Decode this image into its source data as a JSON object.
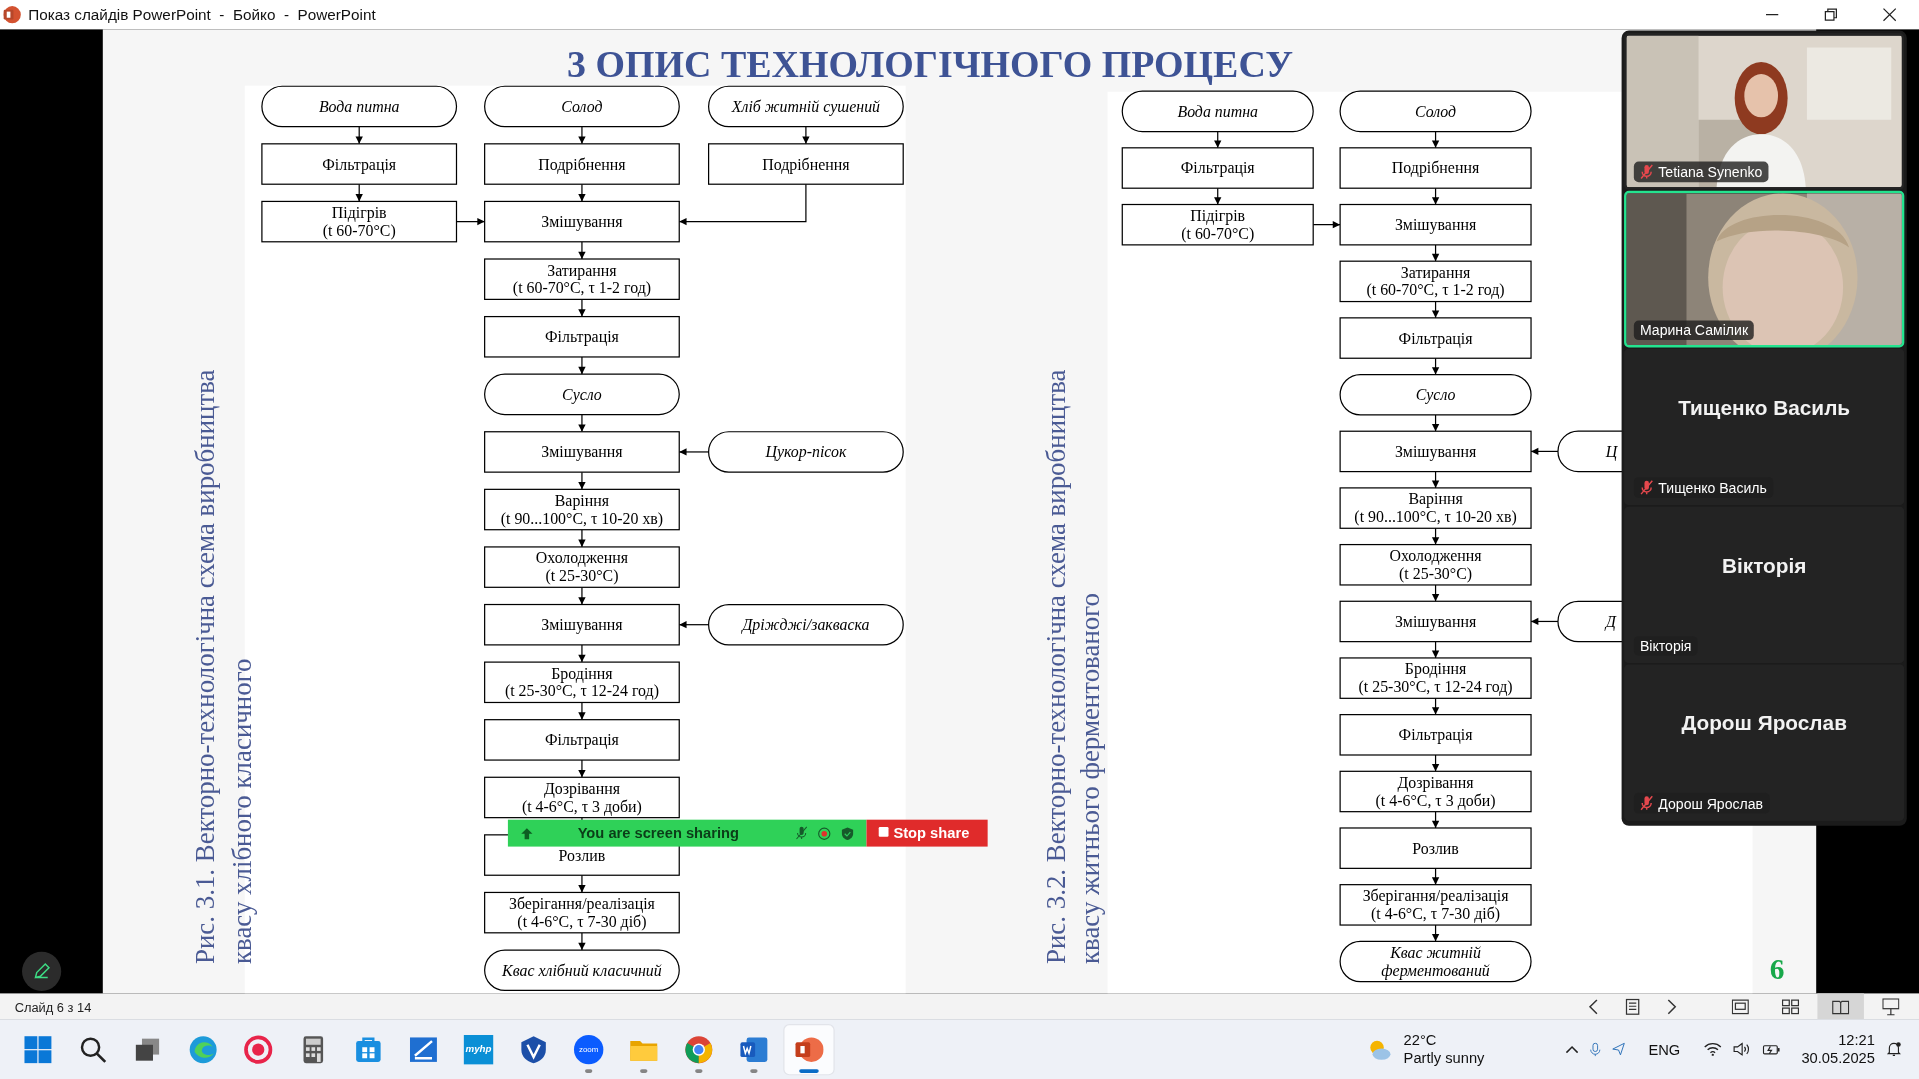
{
  "window": {
    "title": "Показ слайдів PowerPoint  -  Бойко  -  PowerPoint"
  },
  "slide": {
    "title": "3 ОПИС ТЕХНОЛОГІЧНОГО ПРОЦЕСУ",
    "page_number": "6",
    "figures": [
      {
        "caption": [
          "Рис. 3.1. Векторно-технологічна схема виробництва",
          "квасу хлібного класичного"
        ],
        "main": [
          {
            "kind": "terminal",
            "lines": [
              "Солод"
            ]
          },
          {
            "kind": "process",
            "lines": [
              "Подрібнення"
            ]
          },
          {
            "kind": "process",
            "lines": [
              "Змішування"
            ]
          },
          {
            "kind": "process",
            "lines": [
              "Затирання",
              "(t 60-70°C, τ 1-2 год)"
            ]
          },
          {
            "kind": "process",
            "lines": [
              "Фільтрація"
            ]
          },
          {
            "kind": "terminal",
            "lines": [
              "Сусло"
            ]
          },
          {
            "kind": "process",
            "lines": [
              "Змішування"
            ]
          },
          {
            "kind": "process",
            "lines": [
              "Варіння",
              "(t 90...100°C, τ 10-20 хв)"
            ]
          },
          {
            "kind": "process",
            "lines": [
              "Охолодження",
              "(t 25-30°C)"
            ]
          },
          {
            "kind": "process",
            "lines": [
              "Змішування"
            ]
          },
          {
            "kind": "process",
            "lines": [
              "Бродіння",
              "(t 25-30°C, τ 12-24 год)"
            ]
          },
          {
            "kind": "process",
            "lines": [
              "Фільтрація"
            ]
          },
          {
            "kind": "process",
            "lines": [
              "Дозрівання",
              "(t 4-6°C, τ 3 доби)"
            ]
          },
          {
            "kind": "process",
            "lines": [
              "Розлив"
            ]
          },
          {
            "kind": "process",
            "lines": [
              "Зберігання/реалізація",
              "(t 4-6°C, τ 7-30 діб)"
            ]
          },
          {
            "kind": "terminal",
            "lines": [
              "Квас хлібний класичний"
            ]
          }
        ],
        "branches": [
          {
            "nodes": [
              {
                "kind": "terminal",
                "lines": [
                  "Вода питна"
                ]
              },
              {
                "kind": "process",
                "lines": [
                  "Фільтрація"
                ]
              },
              {
                "kind": "process",
                "lines": [
                  "Підігрів",
                  "(t 60-70°C)"
                ]
              }
            ]
          },
          {
            "nodes": [
              {
                "kind": "terminal",
                "lines": [
                  "Хліб житній сушений"
                ]
              },
              {
                "kind": "process",
                "lines": [
                  "Подрібнення"
                ]
              }
            ]
          },
          {
            "nodes": [
              {
                "kind": "terminal",
                "lines": [
                  "Цукор-пісок"
                ]
              }
            ]
          },
          {
            "nodes": [
              {
                "kind": "terminal",
                "lines": [
                  "Дріжджі/закваска"
                ]
              }
            ]
          }
        ]
      },
      {
        "caption": [
          "Рис. 3.2. Векторно-технологічна схема виробництва",
          "квасу житнього ферментованого"
        ],
        "main": [
          {
            "kind": "terminal",
            "lines": [
              "Солод"
            ]
          },
          {
            "kind": "process",
            "lines": [
              "Подрібнення"
            ]
          },
          {
            "kind": "process",
            "lines": [
              "Змішування"
            ]
          },
          {
            "kind": "process",
            "lines": [
              "Затирання",
              "(t 60-70°C, τ 1-2 год)"
            ]
          },
          {
            "kind": "process",
            "lines": [
              "Фільтрація"
            ]
          },
          {
            "kind": "terminal",
            "lines": [
              "Сусло"
            ]
          },
          {
            "kind": "process",
            "lines": [
              "Змішування"
            ]
          },
          {
            "kind": "process",
            "lines": [
              "Варіння",
              "(t 90...100°C, τ 10-20 хв)"
            ]
          },
          {
            "kind": "process",
            "lines": [
              "Охолодження",
              "(t 25-30°C)"
            ]
          },
          {
            "kind": "process",
            "lines": [
              "Змішування"
            ]
          },
          {
            "kind": "process",
            "lines": [
              "Бродіння",
              "(t 25-30°C, τ 12-24 год)"
            ]
          },
          {
            "kind": "process",
            "lines": [
              "Фільтрація"
            ]
          },
          {
            "kind": "process",
            "lines": [
              "Дозрівання",
              "(t 4-6°C, τ 3 доби)"
            ]
          },
          {
            "kind": "process",
            "lines": [
              "Розлив"
            ]
          },
          {
            "kind": "process",
            "lines": [
              "Зберігання/реалізація",
              "(t 4-6°C, τ 7-30 діб)"
            ]
          },
          {
            "kind": "terminal",
            "lines": [
              "Квас житній",
              "ферментований"
            ]
          }
        ],
        "branches": [
          {
            "nodes": [
              {
                "kind": "terminal",
                "lines": [
                  "Вода питна"
                ]
              },
              {
                "kind": "process",
                "lines": [
                  "Фільтрація"
                ]
              },
              {
                "kind": "process",
                "lines": [
                  "Підігрів",
                  "(t 60-70°C)"
                ]
              }
            ]
          },
          {
            "nodes": [
              {
                "kind": "terminal",
                "lines": [
                  "Ц"
                ],
                "clipped": true
              }
            ]
          },
          {
            "nodes": [
              {
                "kind": "terminal",
                "lines": [
                  "Д"
                ],
                "clipped": true
              }
            ]
          }
        ]
      }
    ]
  },
  "share_bar": {
    "status": "You are screen sharing",
    "stop": "Stop share"
  },
  "participants": [
    {
      "kind": "video",
      "name": "Tetiana Synenko",
      "muted": true,
      "speaking": false
    },
    {
      "kind": "video",
      "name": "Марина Самілик",
      "muted": false,
      "speaking": true
    },
    {
      "kind": "avatar",
      "display_name": "Тищенко Василь",
      "name": "Тищенко Василь",
      "muted": true,
      "speaking": false
    },
    {
      "kind": "avatar",
      "display_name": "Вікторія",
      "name": "Вікторія",
      "muted": false,
      "speaking": false
    },
    {
      "kind": "avatar",
      "display_name": "Дорош Ярослав",
      "name": "Дорош Ярослав",
      "muted": true,
      "speaking": false
    }
  ],
  "status_bar": {
    "slide_counter": "Слайд 6 з 14",
    "views": [
      {
        "kind": "normal",
        "selected": false
      },
      {
        "kind": "sorter",
        "selected": false
      },
      {
        "kind": "reading",
        "selected": true
      },
      {
        "kind": "slideshow",
        "selected": false
      }
    ]
  },
  "taskbar": {
    "apps": [
      {
        "kind": "start",
        "running": false,
        "active": false
      },
      {
        "kind": "search",
        "running": false,
        "active": false
      },
      {
        "kind": "task-view",
        "running": false,
        "active": false
      },
      {
        "kind": "edge",
        "running": false,
        "active": false
      },
      {
        "kind": "recorder",
        "running": false,
        "active": false
      },
      {
        "kind": "calculator",
        "running": false,
        "active": false
      },
      {
        "kind": "store",
        "running": false,
        "active": false
      },
      {
        "kind": "scanner",
        "running": false,
        "active": false
      },
      {
        "kind": "myhp",
        "label": "myhp",
        "running": false,
        "active": false
      },
      {
        "kind": "vpn",
        "running": false,
        "active": false
      },
      {
        "kind": "zoom",
        "label": "zoom",
        "running": true,
        "active": false
      },
      {
        "kind": "explorer",
        "running": true,
        "active": false
      },
      {
        "kind": "chrome",
        "running": true,
        "active": false
      },
      {
        "kind": "word",
        "running": true,
        "active": false
      },
      {
        "kind": "powerpoint",
        "running": true,
        "active": true
      }
    ],
    "weather": {
      "temperature": "22°C",
      "condition": "Partly sunny"
    },
    "language": "ENG",
    "time": "12:21",
    "date": "30.05.2025"
  }
}
